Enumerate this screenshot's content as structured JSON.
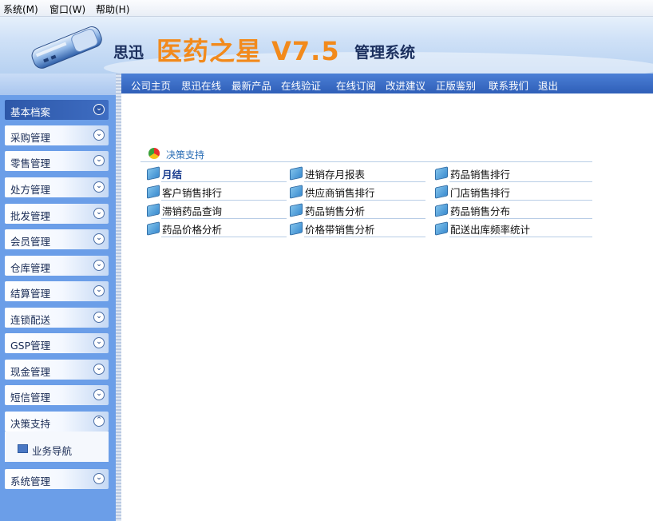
{
  "menubar": {
    "items": [
      "系统(M)",
      "窗口(W)",
      "帮助(H)"
    ]
  },
  "banner": {
    "brand_prefix": "思迅",
    "brand_main": "医药之星 V7.5",
    "brand_suffix": "管理系统"
  },
  "nav": {
    "items": [
      "公司主页",
      "思迅在线",
      "最新产品",
      "在线验证",
      "在线订阅",
      "改进建议",
      "正版鉴别",
      "联系我们",
      "退出"
    ]
  },
  "sidebar": {
    "items": [
      "基本档案",
      "采购管理",
      "零售管理",
      "处方管理",
      "批发管理",
      "会员管理",
      "仓库管理",
      "结算管理",
      "连锁配送",
      "GSP管理",
      "现金管理",
      "短信管理",
      "决策支持",
      "系统管理"
    ],
    "active": "基本档案",
    "expanded": "决策支持",
    "sub_item": "业务导航"
  },
  "content": {
    "section_title": "决策支持",
    "rows": [
      [
        "月结",
        "进销存月报表",
        "药品销售排行"
      ],
      [
        "客户销售排行",
        "供应商销售排行",
        "门店销售排行"
      ],
      [
        "滞销药品查询",
        "药品销售分析",
        "药品销售分布"
      ],
      [
        "药品价格分析",
        "价格带销售分析",
        "配送出库频率统计"
      ]
    ]
  },
  "colors": {
    "sidebar_bg": "#6b9ee8",
    "nav_bg": "#3b6ec6",
    "brand_orange": "#f28a1c",
    "active_item": "#2d57a8"
  }
}
